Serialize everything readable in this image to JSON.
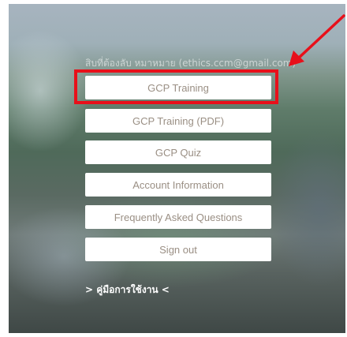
{
  "header": {
    "email_text": "สิบที่ต้องลับ หมาหมาย (ethics.ccm@gmail.com)"
  },
  "menu": {
    "buttons": [
      {
        "label": "GCP Training"
      },
      {
        "label": "GCP Training (PDF)"
      },
      {
        "label": "GCP Quiz"
      },
      {
        "label": "Account Information"
      },
      {
        "label": "Frequently Asked Questions"
      },
      {
        "label": "Sign out"
      }
    ]
  },
  "footer": {
    "manual_link": "> คู่มือการใช้งาน <"
  },
  "annotation": {
    "highlight_color": "#e8101a",
    "arrow_color": "#e8101a"
  }
}
